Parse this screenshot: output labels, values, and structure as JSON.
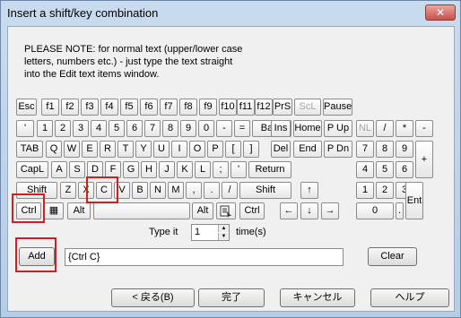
{
  "window": {
    "title": "Insert a shift/key combination",
    "close_glyph": "✕"
  },
  "note": {
    "line1": "PLEASE NOTE: for normal text (upper/lower case",
    "line2": "letters, numbers etc.) - just type the text straight",
    "line3": "into the Edit text items window."
  },
  "keys": {
    "row1": [
      "Esc",
      "f1",
      "f2",
      "f3",
      "f4",
      "f5",
      "f6",
      "f7",
      "f8",
      "f9",
      "f10",
      "f11",
      "f12",
      "PrS",
      "ScL",
      "Pause"
    ],
    "row2": [
      "'",
      "1",
      "2",
      "3",
      "4",
      "5",
      "6",
      "7",
      "8",
      "9",
      "0",
      "-",
      "=",
      "Back",
      "Ins",
      "Home",
      "P Up",
      "NL",
      "/",
      "*",
      "-"
    ],
    "row3": [
      "TAB",
      "Q",
      "W",
      "E",
      "R",
      "T",
      "Y",
      "U",
      "I",
      "O",
      "P",
      "[",
      "]",
      "\\",
      "Del",
      "End",
      "P Dn",
      "7",
      "8",
      "9",
      "+"
    ],
    "row4": [
      "CapL",
      "A",
      "S",
      "D",
      "F",
      "G",
      "H",
      "J",
      "K",
      "L",
      ";",
      "'",
      "Return",
      "4",
      "5",
      "6"
    ],
    "row5": [
      "Shift",
      "Z",
      "X",
      "C",
      "V",
      "B",
      "N",
      "M",
      ",",
      ".",
      "/",
      "Shift",
      "↑",
      "1",
      "2",
      "3",
      "Ent"
    ],
    "row6": [
      "Ctrl",
      "▦",
      "Alt",
      "",
      "Alt",
      "",
      "Ctrl",
      "←",
      "↓",
      "→",
      "0",
      "."
    ]
  },
  "type_it": {
    "label": "Type it",
    "value": "1",
    "suffix": "time(s)"
  },
  "combo_field": {
    "value": "{Ctrl C}"
  },
  "buttons": {
    "add": "Add",
    "clear": "Clear",
    "back": "< 戻る(B)",
    "finish": "完了",
    "cancel": "キャンセル",
    "help": "ヘルプ"
  },
  "colors": {
    "highlight": "#d21e1e"
  }
}
